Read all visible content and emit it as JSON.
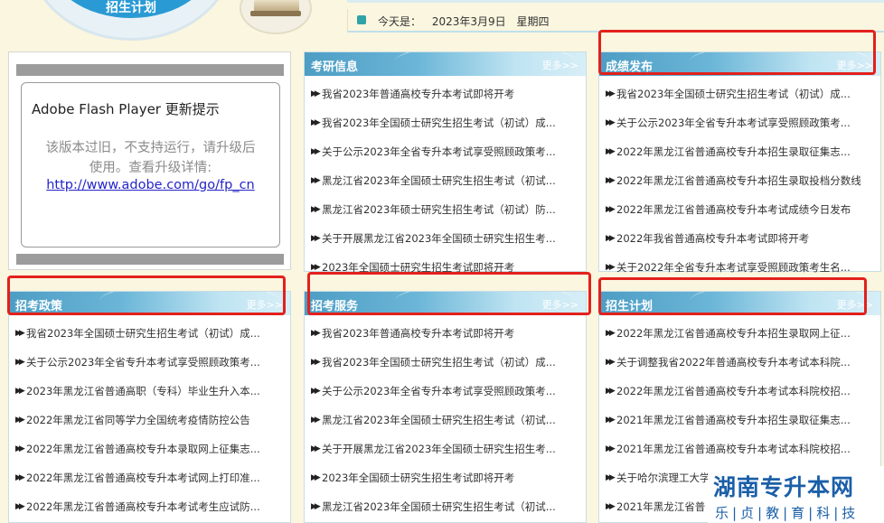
{
  "header": {
    "circle_label": "招生计划",
    "date_label": "今天是：",
    "date_value": "2023年3月9日",
    "weekday": "星期四"
  },
  "flash": {
    "title": "Adobe Flash Player 更新提示",
    "message_line1": "该版本过旧，不支持运行，请升级后",
    "message_line2": "使用。查看升级详情:",
    "link": "http://www.adobe.com/go/fp_cn"
  },
  "panels": {
    "kaoyan": {
      "title": "考研信息",
      "more": "更多>>",
      "items": [
        "我省2023年普通高校专升本考试即将开考",
        "我省2023年全国硕士研究生招生考试（初试）成...",
        "关于公示2023年全省专升本考试享受照顾政策考...",
        "黑龙江省2023年全国硕士研究生招生考试（初试...",
        "黑龙江省2023年硕士研究生招生考试（初试）防...",
        "关于开展黑龙江省2023年全国硕士研究生招生考...",
        "2023年全国硕士研究生招生考试即将开考"
      ]
    },
    "chengji": {
      "title": "成绩发布",
      "more": "更多>>",
      "items": [
        "我省2023年全国硕士研究生招生考试（初试）成...",
        "关于公示2023年全省专升本考试享受照顾政策考...",
        "2022年黑龙江省普通高校专升本招生录取征集志...",
        "2022年黑龙江省普通高校专升本招生录取投档分数线",
        "2022年黑龙江省普通高校专升本考试成绩今日发布",
        "2022年我省普通高校专升本考试即将开考",
        "关于2022年全省专升本考试享受照顾政策考生名..."
      ]
    },
    "zhengce": {
      "title": "招考政策",
      "more": "更多>>",
      "items": [
        "我省2023年全国硕士研究生招生考试（初试）成...",
        "关于公示2023年全省专升本考试享受照顾政策考...",
        "2023年黑龙江省普通高职（专科）毕业生升入本...",
        "2022年黑龙江省同等学力全国统考疫情防控公告",
        "2022年黑龙江省普通高校专升本录取网上征集志...",
        "2022年黑龙江省普通高校专升本考试网上打印准...",
        "2022年黑龙江省普通高校专升本考试考生应试防..."
      ]
    },
    "fuwu": {
      "title": "招考服务",
      "more": "更多>>",
      "items": [
        "我省2023年普通高校专升本考试即将开考",
        "我省2023年全国硕士研究生招生考试（初试）成...",
        "关于公示2023年全省专升本考试享受照顾政策考...",
        "黑龙江省2023年全国硕士研究生招生考试（初试...",
        "关于开展黑龙江省2023年全国硕士研究生招生考...",
        "2023年全国硕士研究生招生考试即将开考",
        "黑龙江省2023年全国硕士研究生招生考试（初试..."
      ]
    },
    "jihua": {
      "title": "招生计划",
      "more": "更多>>",
      "items": [
        "2022年黑龙江省普通高校专升本招生录取网上征...",
        "关于调整我省2022年普通高校专升本考试本科院...",
        "2022年黑龙江省普通高校专升本考试本科院校招...",
        "2021年黑龙江省普通高校专升本招生录取征集志...",
        "2021年黑龙江省普通高校专升本考试本科院校招...",
        "关于哈尔滨理工大学",
        "2021年黑龙江省普"
      ]
    }
  },
  "watermark": {
    "title": "湖南专升本网",
    "subtitle": "乐|贞|教|育|科|技"
  },
  "colors": {
    "page_bg": "#fbf6df",
    "panel_header": "#4d9dc4",
    "highlight": "#e2211c",
    "watermark": "#1b5fa8"
  }
}
